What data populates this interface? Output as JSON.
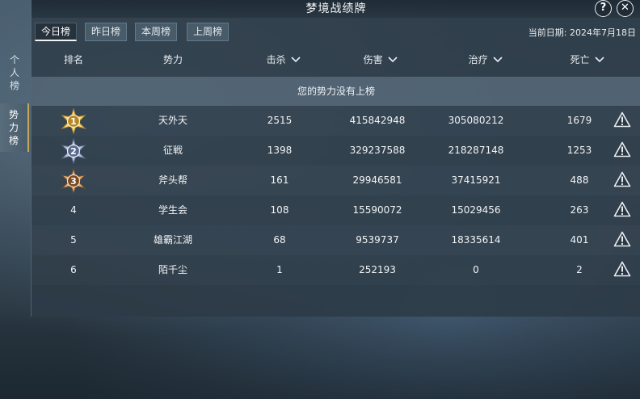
{
  "title": "梦境战绩牌",
  "side_tabs": [
    {
      "label": "个人榜",
      "chars": [
        "个",
        "人",
        "榜"
      ],
      "active": false
    },
    {
      "label": "势力榜",
      "chars": [
        "势",
        "力",
        "榜"
      ],
      "active": true
    }
  ],
  "tabs": [
    {
      "label": "今日榜",
      "active": true
    },
    {
      "label": "昨日榜",
      "active": false
    },
    {
      "label": "本周榜",
      "active": false
    },
    {
      "label": "上周榜",
      "active": false
    }
  ],
  "date_label": "当前日期: 2024年7月18日",
  "headers": {
    "rank": "排名",
    "faction": "势力",
    "kills": "击杀",
    "damage": "伤害",
    "healing": "治疗",
    "deaths": "死亡"
  },
  "notice": "您的势力没有上榜",
  "rows": [
    {
      "rank": "1",
      "faction": "天外天",
      "kills": "2515",
      "damage": "415842948",
      "healing": "305080212",
      "deaths": "1679",
      "medal": "gold"
    },
    {
      "rank": "2",
      "faction": "征戦",
      "kills": "1398",
      "damage": "329237588",
      "healing": "218287148",
      "deaths": "1253",
      "medal": "silver"
    },
    {
      "rank": "3",
      "faction": "斧头帮",
      "kills": "161",
      "damage": "29946581",
      "healing": "37415921",
      "deaths": "488",
      "medal": "bronze"
    },
    {
      "rank": "4",
      "faction": "学生会",
      "kills": "108",
      "damage": "15590072",
      "healing": "15029456",
      "deaths": "263",
      "medal": ""
    },
    {
      "rank": "5",
      "faction": "雄霸江湖",
      "kills": "68",
      "damage": "9539737",
      "healing": "18335614",
      "deaths": "401",
      "medal": ""
    },
    {
      "rank": "6",
      "faction": "陌千尘",
      "kills": "1",
      "damage": "252193",
      "healing": "0",
      "deaths": "2",
      "medal": ""
    }
  ],
  "buttons": {
    "help": "?",
    "close": "✕"
  },
  "colors": {
    "gold": "#e8c25a",
    "silver": "#9aa8c4",
    "bronze": "#c9955a",
    "active_tab_underline": "#f1f4f6"
  }
}
